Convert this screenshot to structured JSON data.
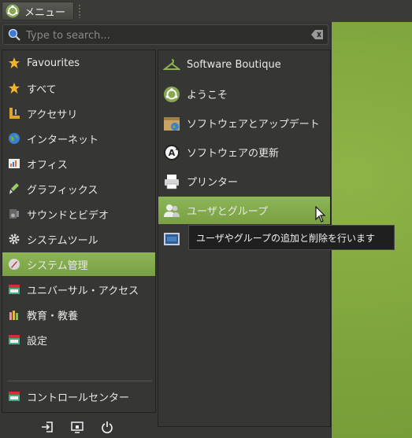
{
  "panel": {
    "menu_label": "メニュー"
  },
  "search": {
    "placeholder": "Type to search..."
  },
  "categories": [
    {
      "label": "Favourites",
      "icon": "star-icon"
    },
    {
      "label": "すべて",
      "icon": "star-icon"
    },
    {
      "label": "アクセサリ",
      "icon": "accessories-icon"
    },
    {
      "label": "インターネット",
      "icon": "globe-icon"
    },
    {
      "label": "オフィス",
      "icon": "office-icon"
    },
    {
      "label": "グラフィックス",
      "icon": "graphics-icon"
    },
    {
      "label": "サウンドとビデオ",
      "icon": "multimedia-icon"
    },
    {
      "label": "システムツール",
      "icon": "gear-icon"
    },
    {
      "label": "システム管理",
      "icon": "system-admin-icon",
      "selected": true
    },
    {
      "label": "ユニバーサル・アクセス",
      "icon": "accessibility-icon"
    },
    {
      "label": "教育・教養",
      "icon": "education-icon"
    },
    {
      "label": "設定",
      "icon": "settings-icon"
    },
    {
      "label": "コントロールセンター",
      "icon": "control-center-icon"
    }
  ],
  "apps": [
    {
      "label": "Software Boutique",
      "icon": "hanger-icon"
    },
    {
      "label": "ようこそ",
      "icon": "ubuntu-mate-icon"
    },
    {
      "label": "ソフトウェアとアップデート",
      "icon": "software-updates-icon"
    },
    {
      "label": "ソフトウェアの更新",
      "icon": "software-updater-icon"
    },
    {
      "label": "プリンター",
      "icon": "printer-icon"
    },
    {
      "label": "ユーザとグループ",
      "icon": "users-icon",
      "selected": true
    },
    {
      "label": "",
      "icon": "monitor-icon"
    }
  ],
  "tooltip": {
    "text": "ユーザやグループの追加と削除を行います"
  },
  "bottom_buttons": [
    {
      "name": "logout-icon"
    },
    {
      "name": "lock-screen-icon"
    },
    {
      "name": "power-icon"
    }
  ],
  "colors": {
    "selection": "#85ac50",
    "panel": "#3a3a37",
    "menu_bg": "#363634"
  }
}
